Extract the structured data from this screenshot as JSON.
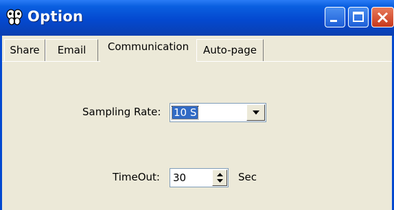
{
  "window": {
    "title": "Option",
    "icon": "butterfly-icon",
    "controls": {
      "minimize": "minimize-icon",
      "maximize": "maximize-icon",
      "close": "close-icon"
    }
  },
  "tabs": [
    {
      "label": "Share",
      "selected": false
    },
    {
      "label": "Email",
      "selected": false
    },
    {
      "label": "Communication",
      "selected": true
    },
    {
      "label": "Auto-page",
      "selected": false
    }
  ],
  "communication": {
    "sampling_rate": {
      "label": "Sampling Rate:",
      "value": "10 S"
    },
    "timeout": {
      "label": "TimeOut:",
      "value": "30",
      "unit": "Sec"
    }
  },
  "colors": {
    "titlebar": "#0449d0",
    "face": "#ece9d8",
    "selection": "#316ac5",
    "close": "#c8381c"
  }
}
